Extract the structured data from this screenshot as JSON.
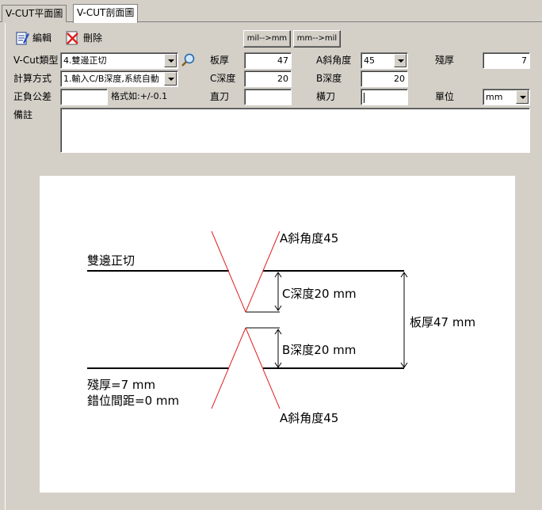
{
  "tabs": [
    {
      "label": "V-CUT平面圖"
    },
    {
      "label": "V-CUT剖面圖"
    }
  ],
  "toolbar": {
    "edit_label": "編輯",
    "delete_label": "刪除",
    "mil_to_mm": "mil-->mm",
    "mm_to_mil": "mm-->mil"
  },
  "form": {
    "vcut_type_label": "V-Cut類型",
    "vcut_type_value": "4.雙邊正切",
    "calc_method_label": "計算方式",
    "calc_method_value": "1.輸入C/B深度,系統自動",
    "tolerance_label": "正負公差",
    "tolerance_value": "",
    "format_hint": "格式如:+/-0.1",
    "remarks_label": "備註",
    "remarks_value": "",
    "board_thickness_label": "板厚",
    "board_thickness_value": "47",
    "c_depth_label": "C深度",
    "c_depth_value": "20",
    "straight_blade_label": "直刀",
    "straight_blade_value": "",
    "a_angle_label": "A斜角度",
    "a_angle_value": "45",
    "b_depth_label": "B深度",
    "b_depth_value": "20",
    "horizontal_blade_label": "橫刀",
    "horizontal_blade_value": "",
    "residual_label": "殘厚",
    "residual_value": "7",
    "unit_label": "單位",
    "unit_value": "mm"
  },
  "diagram": {
    "type_title": "雙邊正切",
    "a_angle_top": "A斜角度45",
    "a_angle_bottom": "A斜角度45",
    "c_depth_text": "C深度20 mm",
    "b_depth_text": "B深度20 mm",
    "board_thickness_text": "板厚47 mm",
    "residual_text": "殘厚=7 mm",
    "offset_text": "錯位間距=0 mm",
    "line_color": "#e02020"
  }
}
